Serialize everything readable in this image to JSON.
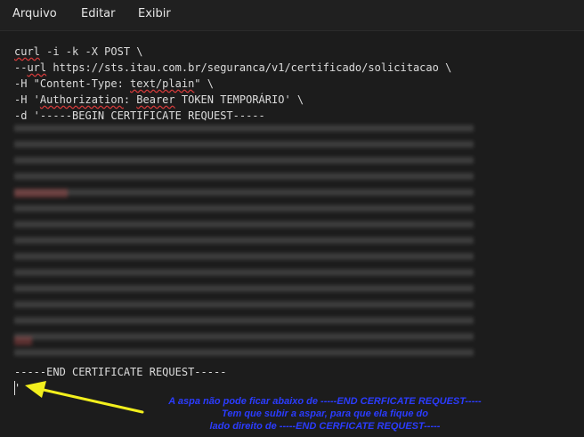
{
  "menu": {
    "items": [
      "Arquivo",
      "Editar",
      "Exibir"
    ]
  },
  "editor": {
    "lines": [
      "curl -i -k -X POST \\",
      "--url https://sts.itau.com.br/seguranca/v1/certificado/solicitacao \\",
      "-H \"Content-Type: text/plain\" \\",
      "-H 'Authorization: Bearer TOKEN TEMPORÁRIO' \\",
      "-d '-----BEGIN CERTIFICATE REQUEST-----"
    ],
    "end_line": "-----END CERTIFICATE REQUEST-----",
    "last_line": "'"
  },
  "annotation": {
    "lines": [
      "A aspa não pode ficar abaixo de -----END CERFICATE REQUEST-----",
      "Tem que subir a aspar, para que ela fique do",
      "lado direito de -----END CERFICATE REQUEST-----"
    ],
    "color": "#2b3cff",
    "arrow_color": "#f2ef1d"
  }
}
